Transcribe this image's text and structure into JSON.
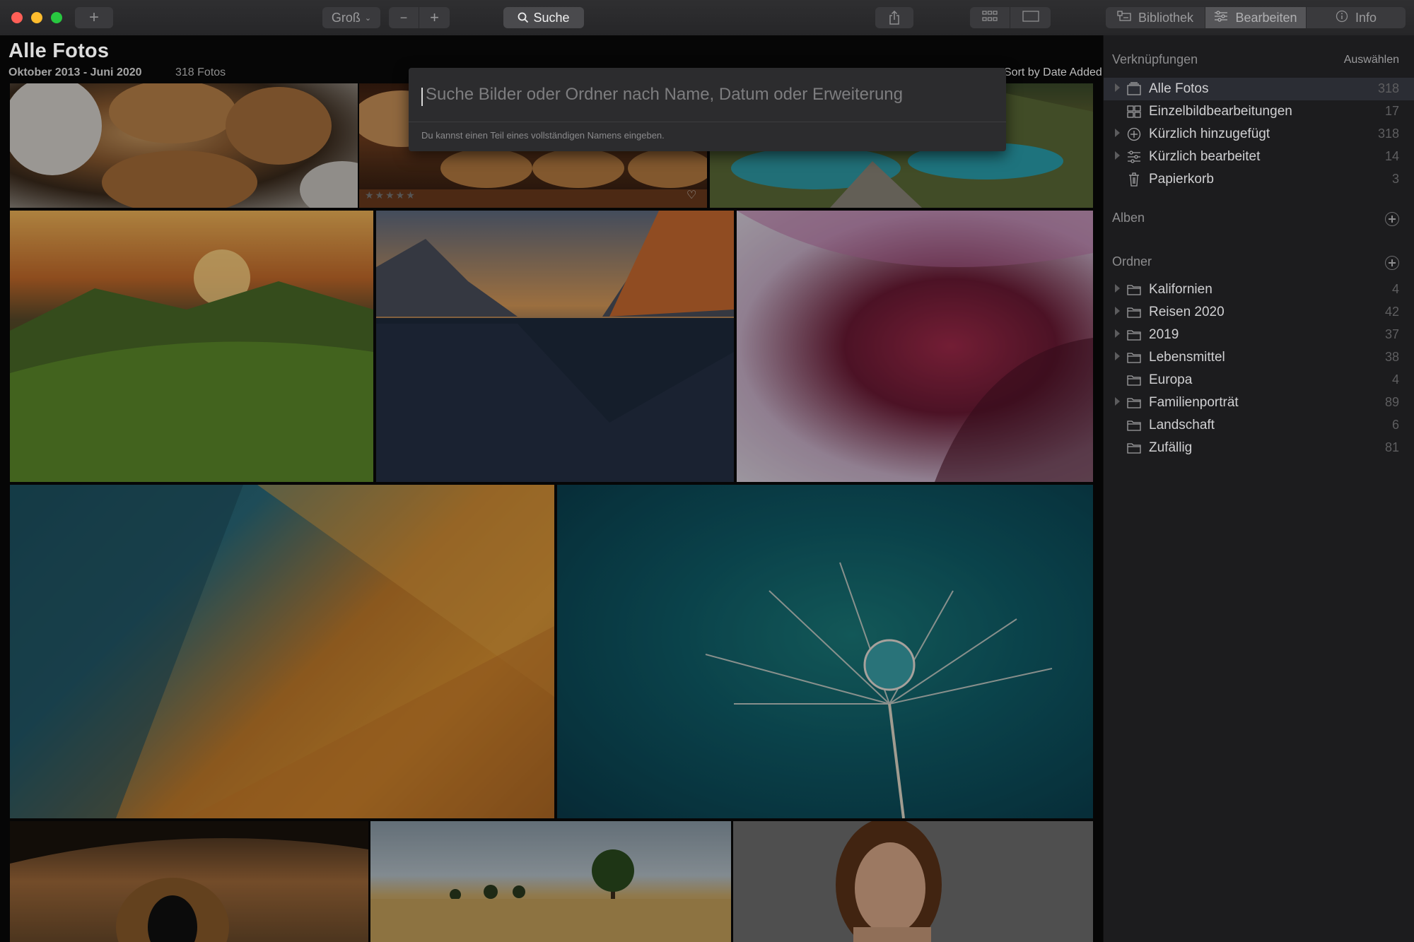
{
  "toolbar": {
    "add_label": "+",
    "size_label": "Groß",
    "zoom_out": "−",
    "zoom_in": "+",
    "search_label": "Suche",
    "tab_library": "Bibliothek",
    "tab_edit": "Bearbeiten",
    "tab_info": "Info"
  },
  "header": {
    "title": "Alle Fotos",
    "date_range": "Oktober 2013 - Juni 2020",
    "count": "318 Fotos",
    "sort_label": "Sort by Date Added"
  },
  "search": {
    "placeholder": "Suche Bilder oder Ordner nach Name, Datum oder Erweiterung",
    "hint": "Du kannst einen Teil eines vollständigen Namens eingeben."
  },
  "sidebar": {
    "shortcuts_heading": "Verknüpfungen",
    "select_label": "Auswählen",
    "shortcuts": [
      {
        "label": "Alle Fotos",
        "count": "318"
      },
      {
        "label": "Einzelbildbearbeitungen",
        "count": "17"
      },
      {
        "label": "Kürzlich hinzugefügt",
        "count": "318"
      },
      {
        "label": "Kürzlich bearbeitet",
        "count": "14"
      },
      {
        "label": "Papierkorb",
        "count": "3"
      }
    ],
    "albums_heading": "Alben",
    "folders_heading": "Ordner",
    "folders": [
      {
        "label": "Kalifornien",
        "count": "4"
      },
      {
        "label": "Reisen 2020",
        "count": "42"
      },
      {
        "label": "2019",
        "count": "37"
      },
      {
        "label": "Lebensmittel",
        "count": "38"
      },
      {
        "label": "Europa",
        "count": "4"
      },
      {
        "label": "Familienporträt",
        "count": "89"
      },
      {
        "label": "Landschaft",
        "count": "6"
      },
      {
        "label": "Zufällig",
        "count": "81"
      }
    ]
  },
  "colors": {
    "accent_selected": "#2b2d34",
    "traffic_red": "#ff5f57",
    "traffic_yellow": "#febc2e",
    "traffic_green": "#28c840"
  }
}
